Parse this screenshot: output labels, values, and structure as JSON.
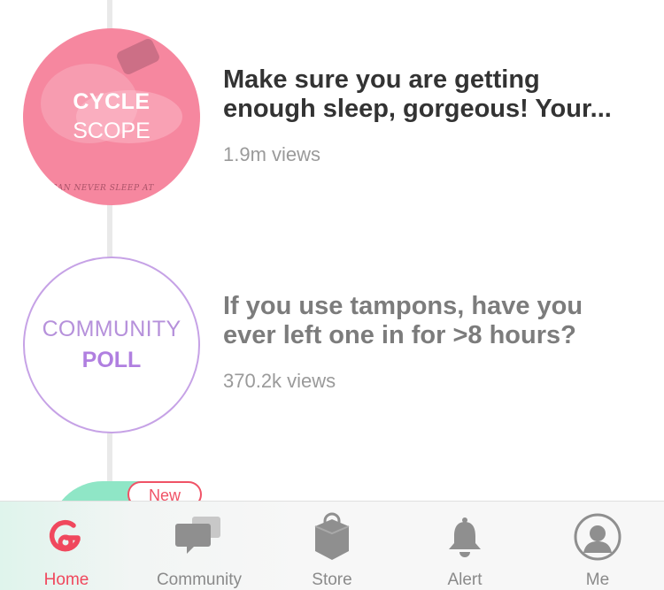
{
  "feed": {
    "items": [
      {
        "circle_line1": "CYCLE",
        "circle_line2": "SCOPE",
        "art_caption": "I CAN NEVER SLEEP AT",
        "title": "Make sure you are getting enough sleep, gorgeous! Your...",
        "views": "1.9m views"
      },
      {
        "circle_line1": "COMMUNITY",
        "circle_line2": "POLL",
        "title": "If you use tampons, have you ever left one in for >8 hours?",
        "views": "370.2k views"
      }
    ],
    "badge": "New"
  },
  "tabbar": {
    "tabs": [
      {
        "label": "Home",
        "icon": "glow-logo-icon",
        "active": true
      },
      {
        "label": "Community",
        "icon": "chat-bubbles-icon",
        "active": false
      },
      {
        "label": "Store",
        "icon": "shopping-bag-icon",
        "active": false
      },
      {
        "label": "Alert",
        "icon": "bell-icon",
        "active": false
      },
      {
        "label": "Me",
        "icon": "profile-icon",
        "active": false
      }
    ]
  },
  "colors": {
    "accent": "#f0485d",
    "cycle_scope_bg": "#f6879f",
    "poll_purple": "#b07fe0",
    "inactive_tab": "#8a8a8a"
  }
}
